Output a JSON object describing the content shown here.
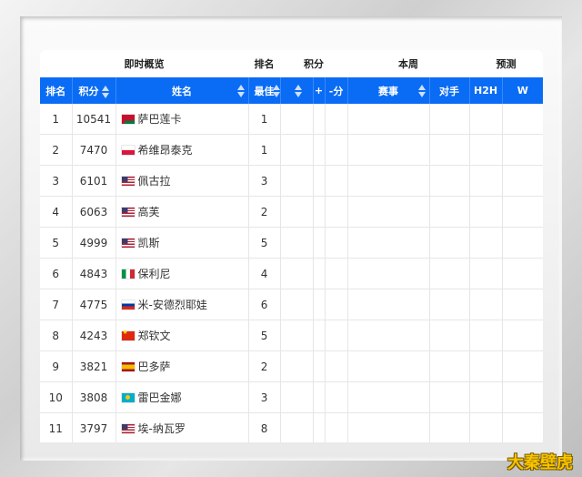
{
  "top_header": {
    "overview": "即时概览",
    "rank_group": "排名",
    "points_group": "积分",
    "this_week": "本周",
    "forecast": "预测"
  },
  "columns": {
    "rank": "排名",
    "points": "积分",
    "name": "姓名",
    "best": "最佳",
    "c5": "",
    "c6": "+",
    "c7": "-分",
    "event": "赛事",
    "opponent": "对手",
    "h2h": "H2H",
    "w": "W"
  },
  "rows": [
    {
      "rank": "1",
      "points": "10541",
      "flag": "by",
      "name": "萨巴莲卡",
      "best": "1"
    },
    {
      "rank": "2",
      "points": "7470",
      "flag": "pl",
      "name": "希维昂泰克",
      "best": "1"
    },
    {
      "rank": "3",
      "points": "6101",
      "flag": "us",
      "name": "佩古拉",
      "best": "3"
    },
    {
      "rank": "4",
      "points": "6063",
      "flag": "us",
      "name": "高芙",
      "best": "2"
    },
    {
      "rank": "5",
      "points": "4999",
      "flag": "us",
      "name": "凯斯",
      "best": "5"
    },
    {
      "rank": "6",
      "points": "4843",
      "flag": "it",
      "name": "保利尼",
      "best": "4"
    },
    {
      "rank": "7",
      "points": "4775",
      "flag": "ru",
      "name": "米-安德烈耶娃",
      "best": "6"
    },
    {
      "rank": "8",
      "points": "4243",
      "flag": "cn",
      "name": "郑钦文",
      "best": "5"
    },
    {
      "rank": "9",
      "points": "3821",
      "flag": "es",
      "name": "巴多萨",
      "best": "2"
    },
    {
      "rank": "10",
      "points": "3808",
      "flag": "kz",
      "name": "雷巴金娜",
      "best": "3"
    },
    {
      "rank": "11",
      "points": "3797",
      "flag": "us",
      "name": "埃-纳瓦罗",
      "best": "8"
    }
  ],
  "watermark": "大秦壁虎"
}
